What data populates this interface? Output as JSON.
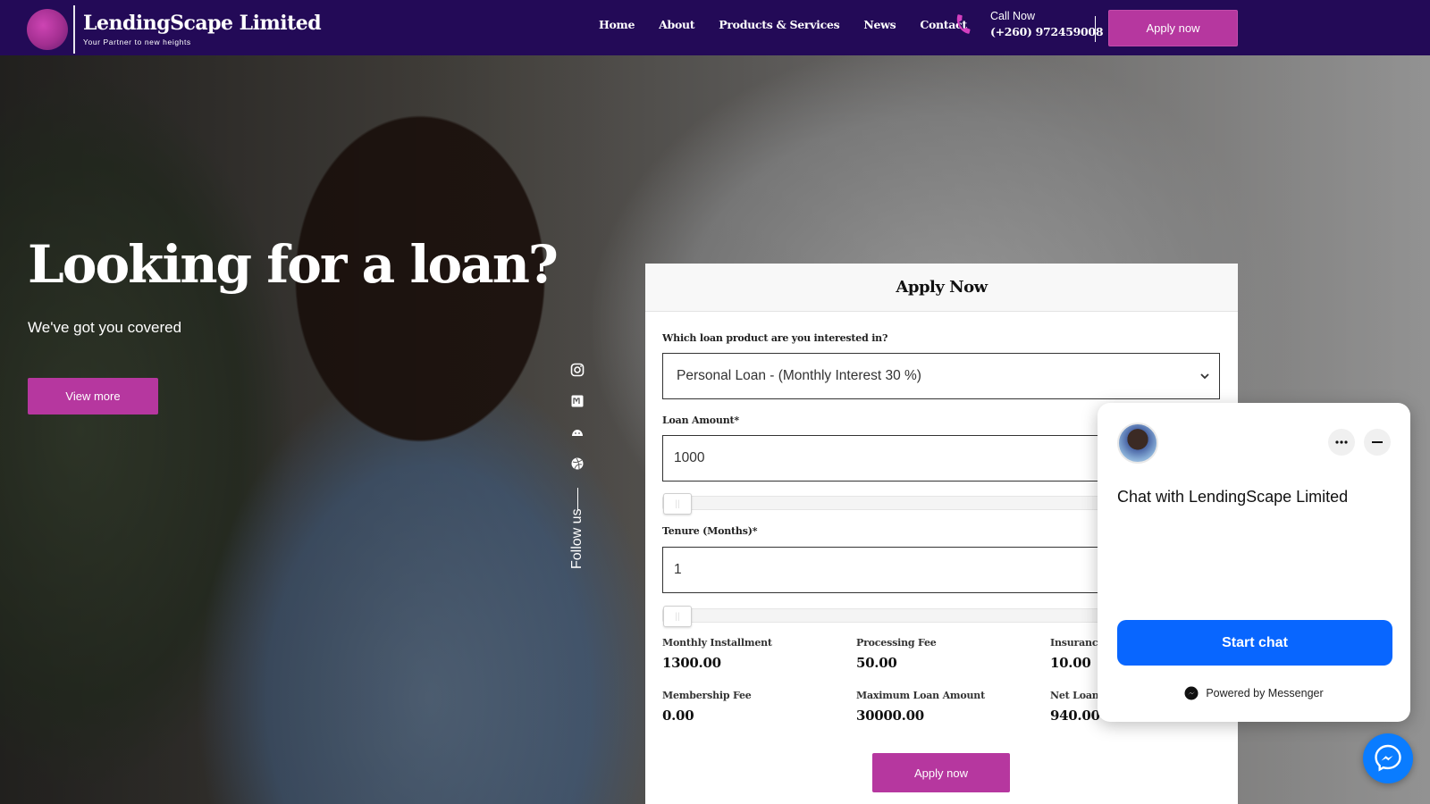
{
  "header": {
    "brand_name": "LendingScape Limited",
    "brand_tagline": "Your Partner to new heights",
    "nav": [
      {
        "label": "Home"
      },
      {
        "label": "About"
      },
      {
        "label": "Products & Services"
      },
      {
        "label": "News"
      },
      {
        "label": "Contact"
      }
    ],
    "call_label": "Call Now",
    "call_number": "(+260) 972459008",
    "apply_label": "Apply now"
  },
  "hero": {
    "title": "Looking for a loan?",
    "subtitle": "We've got you covered",
    "view_more_label": "View more",
    "follow_label": "Follow us",
    "social_icons": [
      "instagram-icon",
      "meetup-icon",
      "android-icon",
      "dribbble-icon"
    ]
  },
  "form": {
    "title": "Apply Now",
    "product_label": "Which loan product are you interested in?",
    "product_selected": "Personal Loan - (Monthly Interest 30 %)",
    "amount_label": "Loan Amount*",
    "amount_value": "1000",
    "amount_slider_fraction": 0.0,
    "tenure_label": "Tenure (Months)*",
    "tenure_value": "1",
    "tenure_slider_fraction": 0.0,
    "stats": [
      {
        "label": "Monthly Installment",
        "value": "1300.00"
      },
      {
        "label": "Processing Fee",
        "value": "50.00"
      },
      {
        "label": "Insurance",
        "value": "10.00"
      },
      {
        "label": "Membership Fee",
        "value": "0.00"
      },
      {
        "label": "Maximum Loan Amount",
        "value": "30000.00"
      },
      {
        "label": "Net Loan",
        "value": "940.00"
      }
    ],
    "apply_label": "Apply now"
  },
  "chat": {
    "title": "Chat with LendingScape Limited",
    "more_icon": "more-icon",
    "minimize_icon": "minimize-icon",
    "start_label": "Start chat",
    "powered_label": "Powered by Messenger",
    "accent": "#0866ff"
  },
  "colors": {
    "header_bg": "#230a57",
    "accent": "#b6379f"
  }
}
